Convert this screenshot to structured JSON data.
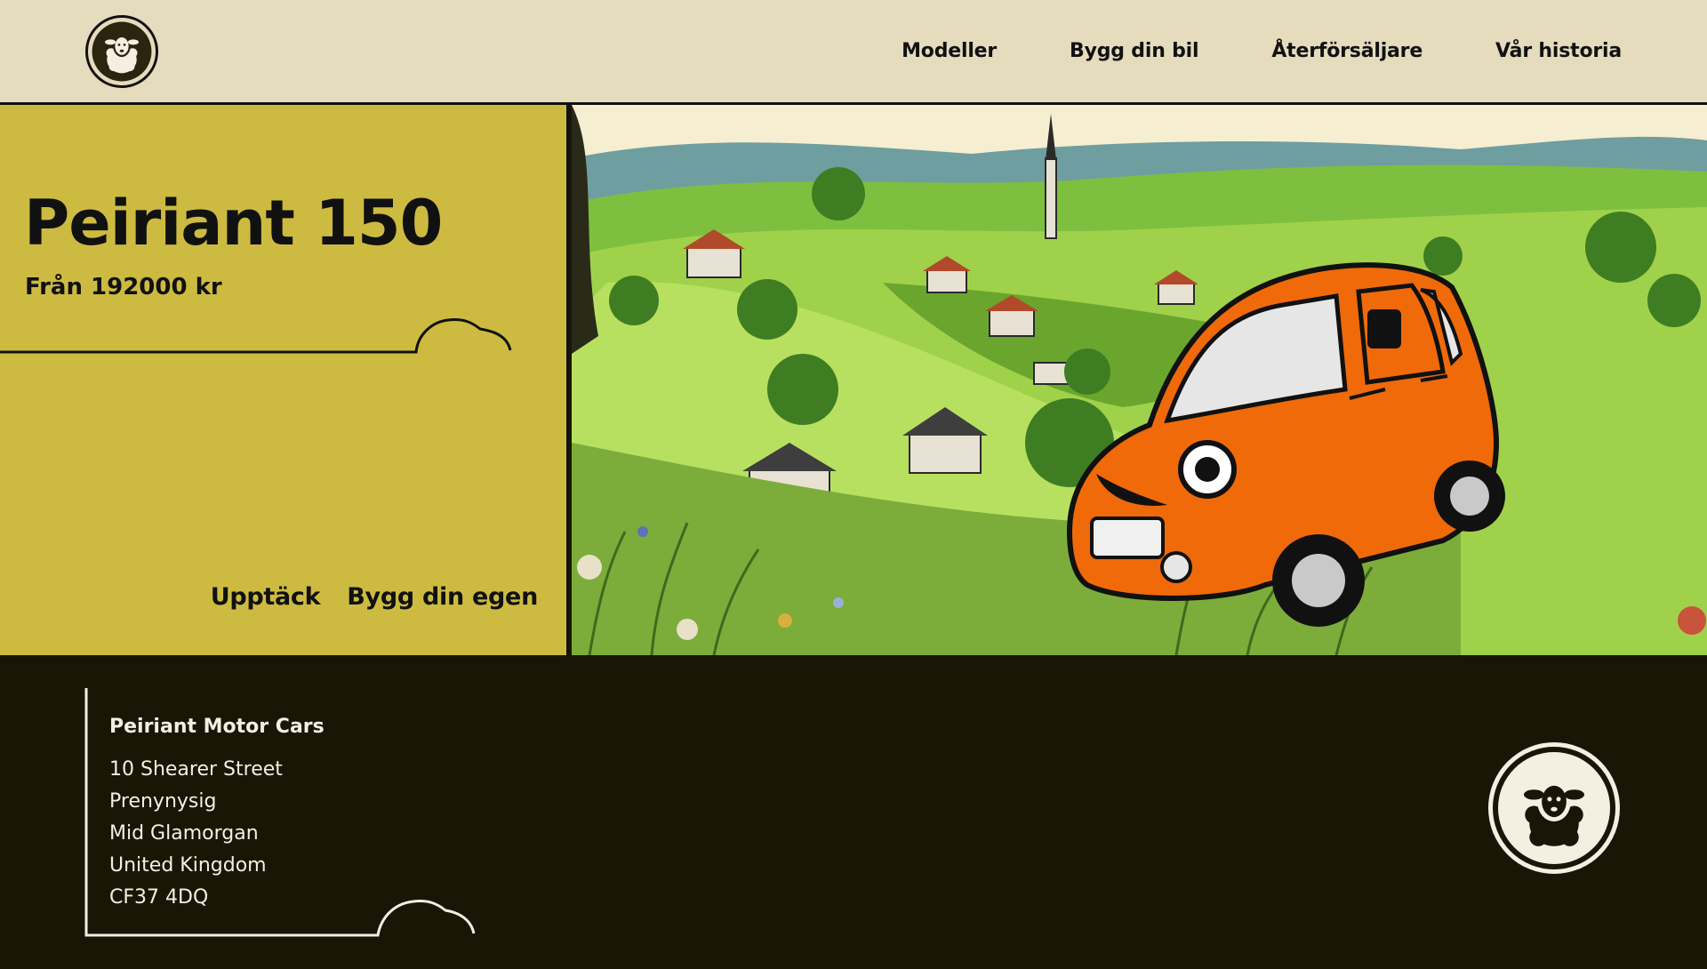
{
  "header": {
    "logo": "sheep-logo-icon",
    "nav": [
      "Modeller",
      "Bygg din bil",
      "Återförsäljare",
      "Vår historia"
    ]
  },
  "hero": {
    "title": "Peiriant 150",
    "price": "Från 192000 kr",
    "actions": [
      "Upptäck",
      "Bygg din egen"
    ],
    "image": "orange-car-countryside-illustration"
  },
  "footer": {
    "company": "Peiriant Motor Cars",
    "address": [
      "10 Shearer Street",
      "Prenynysig",
      "Mid Glamorgan",
      "United Kingdom",
      "CF37 4DQ"
    ],
    "logo": "sheep-logo-icon"
  },
  "colors": {
    "header_bg": "#e5dbbd",
    "hero_accent": "#cdbb41",
    "footer_bg": "#1a1605",
    "car": "#f06a0a"
  }
}
